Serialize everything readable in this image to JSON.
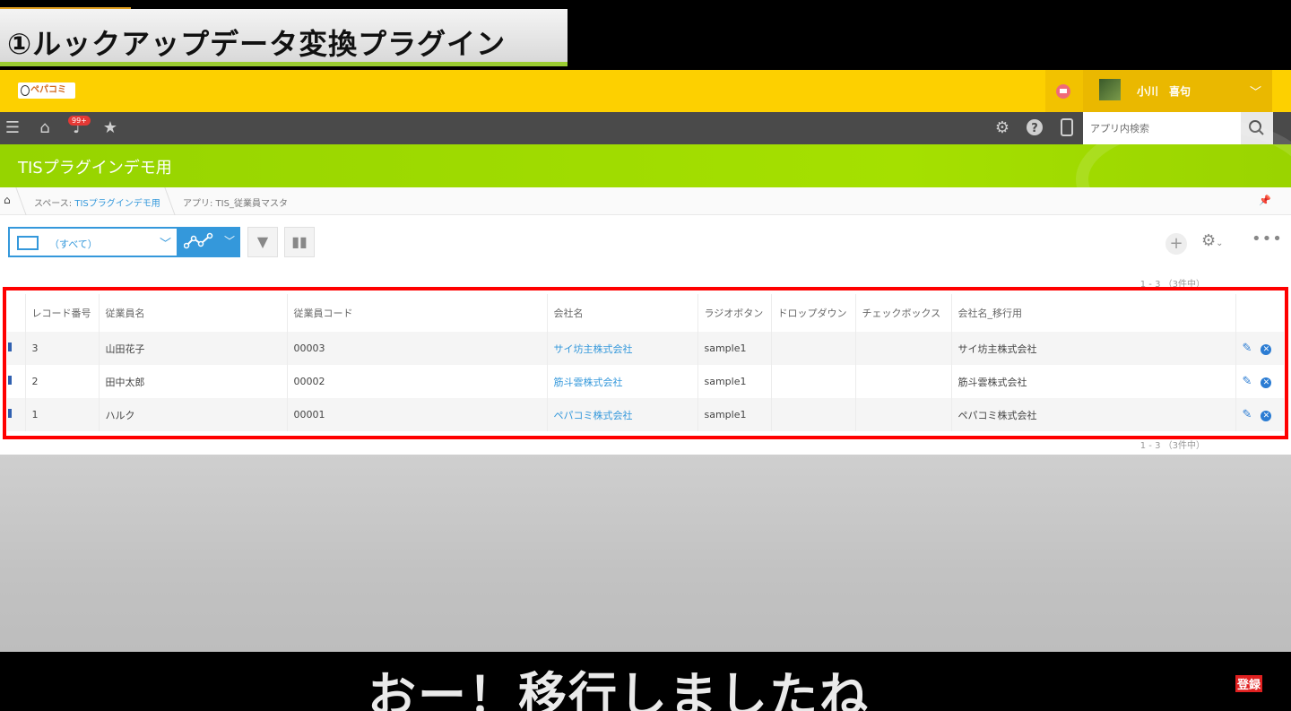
{
  "video_title": "①ルックアップデータ変換プラグイン",
  "header": {
    "logo_text": "ペパコミ",
    "user_name": "小川　喜句",
    "chevron": "﹀"
  },
  "nav": {
    "notification_badge": "99+",
    "search_placeholder": "アプリ内検索"
  },
  "app_title": "TISプラグインデモ用",
  "breadcrumb": {
    "space_prefix": "スペース: ",
    "space_name": "TISプラグインデモ用",
    "app_label": "アプリ: TIS_従業員マスタ"
  },
  "view": {
    "selected": "（すべて）"
  },
  "pager_text": "1 - 3 （3件中）",
  "table": {
    "columns": [
      "レコード番号",
      "従業員名",
      "従業員コード",
      "会社名",
      "ラジオボタン",
      "ドロップダウン",
      "チェックボックス",
      "会社名_移行用",
      ""
    ],
    "rows": [
      [
        "3",
        "山田花子",
        "00003",
        "サイ坊主株式会社",
        "sample1",
        "",
        "",
        "サイ坊主株式会社"
      ],
      [
        "2",
        "田中太郎",
        "00002",
        "筋斗雲株式会社",
        "sample1",
        "",
        "",
        "筋斗雲株式会社"
      ],
      [
        "1",
        "ハルク",
        "00001",
        "ペパコミ株式会社",
        "sample1",
        "",
        "",
        "ペパコミ株式会社"
      ]
    ]
  },
  "subtitle": "おー！移行しましたね",
  "subscribe_label": "登録",
  "colors": {
    "header_yellow": "#fdd000",
    "app_green": "#a5e000",
    "highlight_red": "#ff0000",
    "link_blue": "#3498db"
  }
}
